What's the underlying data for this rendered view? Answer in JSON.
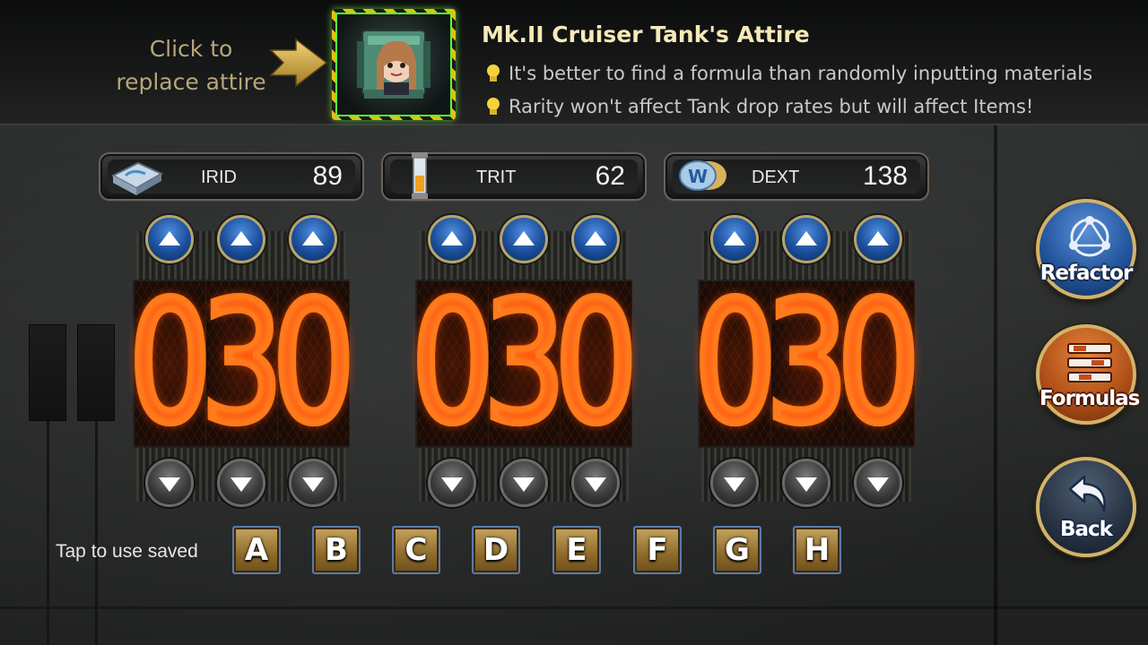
{
  "header": {
    "replace_label": "Click to replace attire",
    "title": "Mk.II Cruiser Tank's Attire",
    "tips": [
      "It's better to find a formula than randomly inputting materials",
      "Rarity won't affect Tank drop rates but will affect Items!"
    ]
  },
  "resources": [
    {
      "name": "IRID",
      "value": "89"
    },
    {
      "name": "TRIT",
      "value": "62"
    },
    {
      "name": "DEXT",
      "value": "138"
    }
  ],
  "inputs": [
    {
      "digits": [
        "0",
        "3",
        "0"
      ]
    },
    {
      "digits": [
        "0",
        "3",
        "0"
      ]
    },
    {
      "digits": [
        "0",
        "3",
        "0"
      ]
    }
  ],
  "saved": {
    "label": "Tap to use saved",
    "slots": [
      "A",
      "B",
      "C",
      "D",
      "E",
      "F",
      "G",
      "H"
    ]
  },
  "side_buttons": {
    "refactor": "Refactor",
    "formulas": "Formulas",
    "back": "Back"
  },
  "colors": {
    "nixie": "#ff7a1a",
    "accent_gold": "#d2b36a",
    "highlight_green": "#5dff3a"
  }
}
